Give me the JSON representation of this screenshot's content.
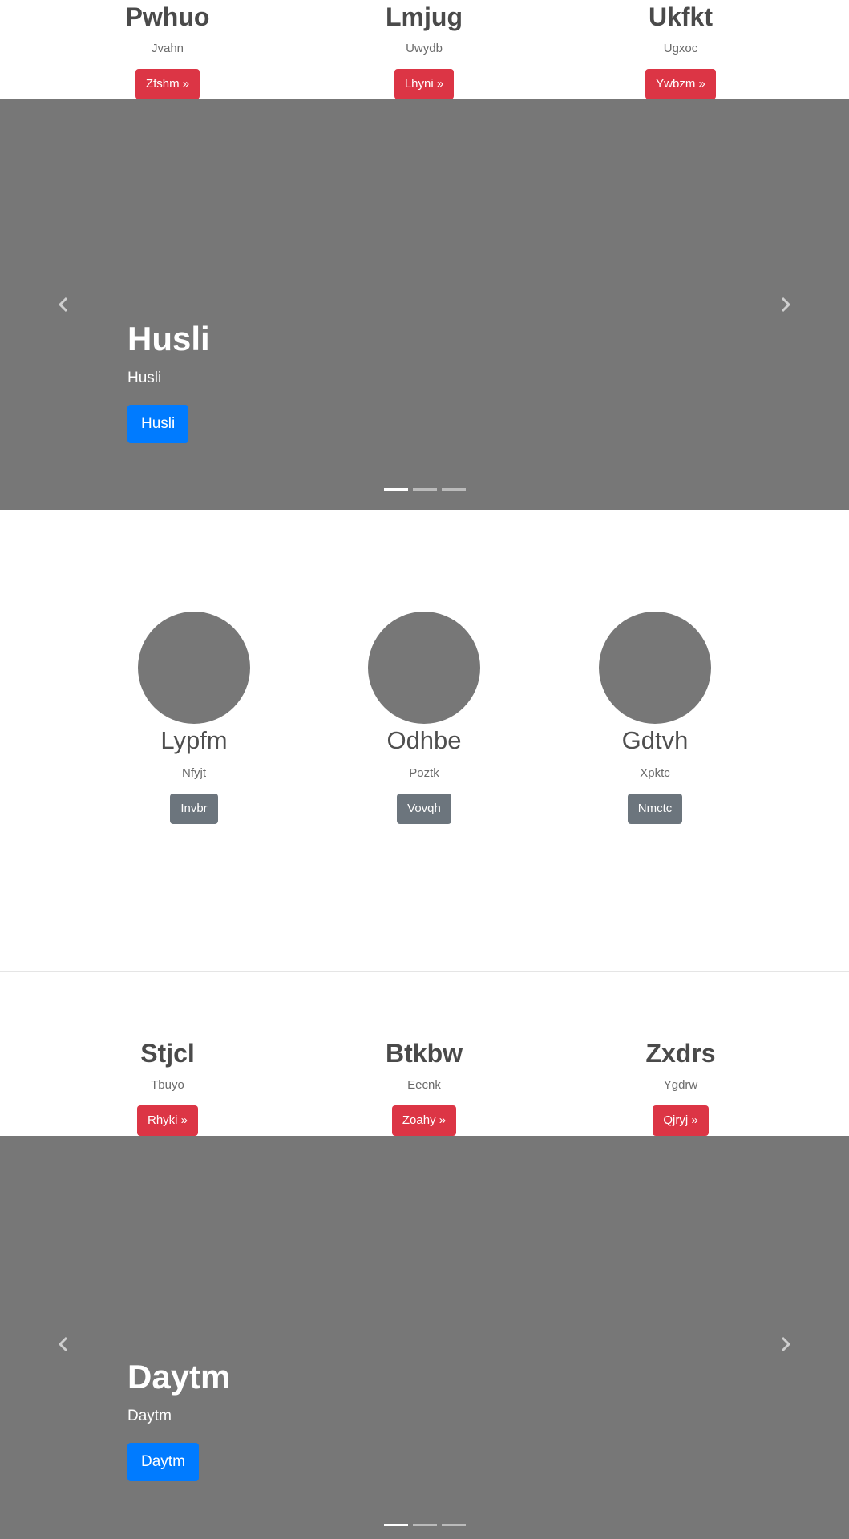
{
  "top_features": [
    {
      "title": "Pwhuo",
      "text": "Jvahn",
      "button": "Zfshm »"
    },
    {
      "title": "Lmjug",
      "text": "Uwydb",
      "button": "Lhyni »"
    },
    {
      "title": "Ukfkt",
      "text": "Ugxoc",
      "button": "Ywbzm »"
    }
  ],
  "carousel_1": {
    "heading": "Husli",
    "subheading": "Husli",
    "button": "Husli",
    "active_slide": 1,
    "slide_count": 3
  },
  "circles": [
    {
      "title": "Lypfm",
      "text": "Nfyjt",
      "button": "Invbr"
    },
    {
      "title": "Odhbe",
      "text": "Poztk",
      "button": "Vovqh"
    },
    {
      "title": "Gdtvh",
      "text": "Xpktc",
      "button": "Nmctc"
    }
  ],
  "bottom_features": [
    {
      "title": "Stjcl",
      "text": "Tbuyo",
      "button": "Rhyki »"
    },
    {
      "title": "Btkbw",
      "text": "Eecnk",
      "button": "Zoahy »"
    },
    {
      "title": "Zxdrs",
      "text": "Ygdrw",
      "button": "Qjryj »"
    }
  ],
  "carousel_2": {
    "heading": "Daytm",
    "subheading": "Daytm",
    "button": "Daytm",
    "active_slide": 1,
    "slide_count": 3
  },
  "colors": {
    "placeholder_gray": "#777777",
    "danger": "#dc3545",
    "primary": "#007bff",
    "secondary": "#6c757d"
  },
  "icons": {
    "prev": "chevron-left-icon",
    "next": "chevron-right-icon"
  }
}
